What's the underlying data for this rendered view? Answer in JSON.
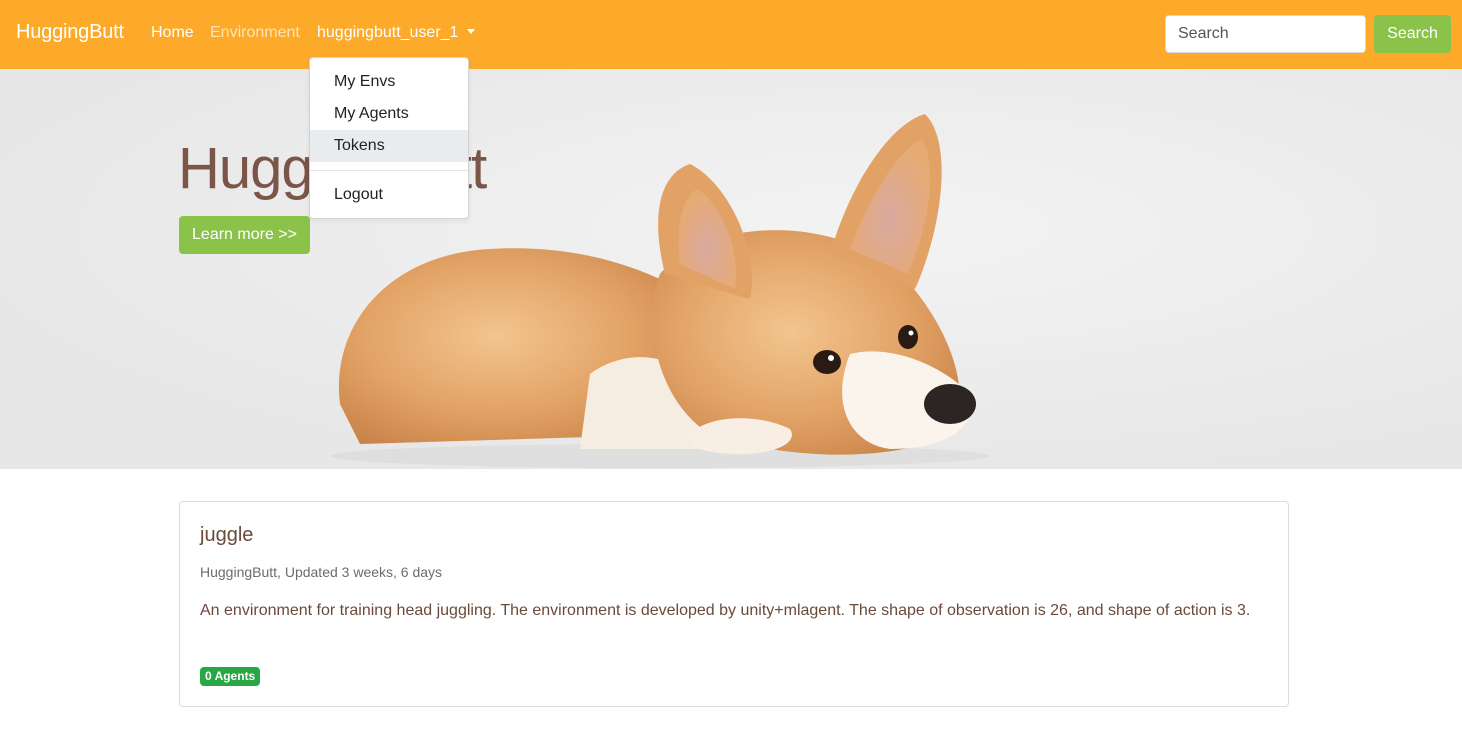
{
  "navbar": {
    "brand": "HuggingButt",
    "links": [
      {
        "label": "Home",
        "state": "active"
      },
      {
        "label": "Environment",
        "state": "muted"
      }
    ],
    "user_menu_label": "huggingbutt_user_1",
    "search_placeholder": "Search",
    "search_button": "Search"
  },
  "dropdown": {
    "items": [
      "My Envs",
      "My Agents",
      "Tokens"
    ],
    "highlighted": "Tokens",
    "logout": "Logout"
  },
  "hero": {
    "title": "HuggingButt",
    "learn_more": "Learn more >>"
  },
  "card": {
    "title": "juggle",
    "meta": "HuggingButt, Updated 3 weeks, 6 days",
    "description": "An environment for training head juggling. The environment is developed by unity+mlagent. The shape of observation is 26, and shape of action is 3.",
    "badge": "0 Agents"
  },
  "colors": {
    "navbar": "#fdaa2a",
    "accent_green": "#8bc34a",
    "badge_green": "#28a745",
    "text_brown": "#6b4a3a"
  }
}
